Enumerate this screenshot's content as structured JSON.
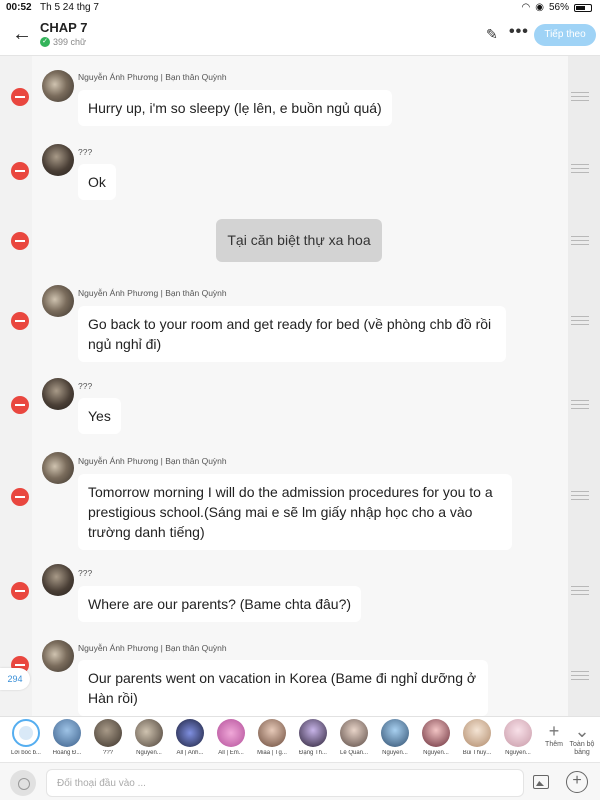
{
  "status_bar": {
    "time": "00:52",
    "date": "Th 5 24 thg 7",
    "battery": "56%"
  },
  "header": {
    "title": "CHAP 7",
    "word_count": "399 chữ",
    "next_label": "Tiếp theo"
  },
  "messages": [
    {
      "sender": "Nguyễn Ánh Phương | Bạn thân Quỳnh",
      "text": "Hurry up, i'm so sleepy (lẹ lên, e buồn ngủ quá)"
    },
    {
      "sender": "???",
      "text": "Ok"
    },
    {
      "narration": "Tại căn biệt thự xa hoa"
    },
    {
      "sender": "Nguyễn Ánh Phương | Bạn thân Quỳnh",
      "text": "Go back to your room and get ready for bed (về phòng chb đồ rồi ngủ nghỉ đi)"
    },
    {
      "sender": "???",
      "text": "Yes"
    },
    {
      "sender": "Nguyễn Ánh Phương | Bạn thân Quỳnh",
      "text": "Tomorrow morning I will do the admission procedures for you to a prestigious school.(Sáng mai e sẽ lm giấy nhập học cho a vào trường danh tiếng)"
    },
    {
      "sender": "???",
      "text": "Where are our parents? (Bame chta đâu?)"
    },
    {
      "sender": "Nguyễn Ánh Phương | Bạn thân Quỳnh",
      "text": "Our parents went on vacation in Korea (Bame đi nghỉ dưỡng ở Hàn rồi)"
    }
  ],
  "message_count": "294",
  "characters": [
    {
      "name": "Lời bốc b..."
    },
    {
      "name": "Hoàng Đ..."
    },
    {
      "name": "???"
    },
    {
      "name": "Nguyễn..."
    },
    {
      "name": "All | Anh..."
    },
    {
      "name": "All | Em..."
    },
    {
      "name": "Miaa | Tg..."
    },
    {
      "name": "Đặng Th..."
    },
    {
      "name": "Lê Quan..."
    },
    {
      "name": "Nguyễn..."
    },
    {
      "name": "Nguyễn..."
    },
    {
      "name": "Bùi Thuỳ..."
    },
    {
      "name": "Nguyễn..."
    }
  ],
  "strip_actions": {
    "add_label": "Thêm",
    "expand_label": "Toàn bộ bảng"
  },
  "input": {
    "placeholder": "Đối thoại đầu vào ..."
  },
  "colors": {
    "accent": "#9fd3f6",
    "delete": "#e9473f",
    "selected_ring": "#55aef0"
  }
}
